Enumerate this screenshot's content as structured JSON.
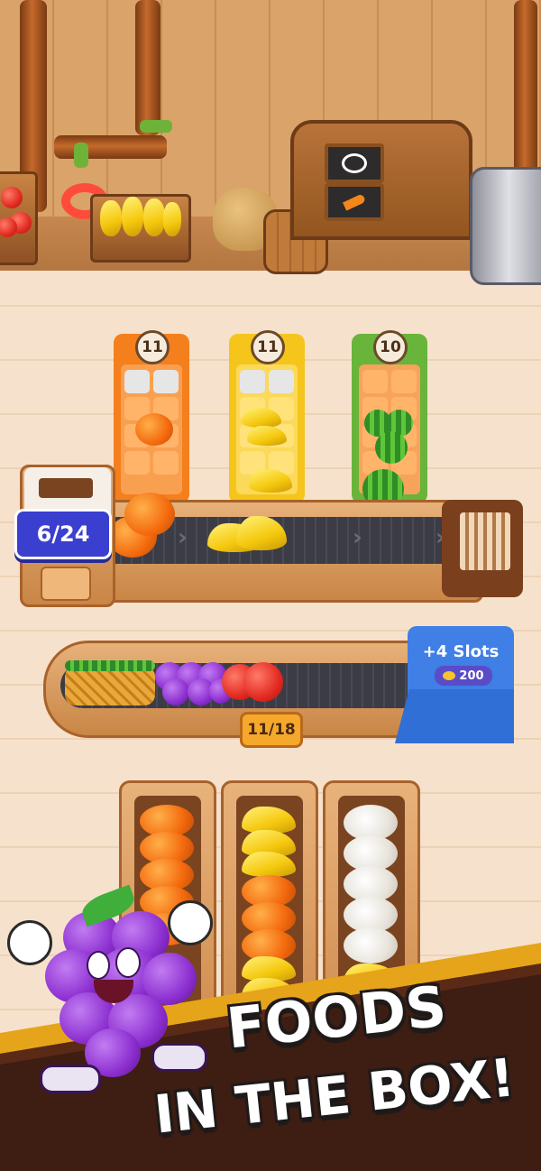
{
  "counters": {
    "belt_count": "6/24",
    "queue_count": "11/18"
  },
  "trays": [
    {
      "count": "11",
      "fruit": "pumpkin",
      "color": "#f47f1c"
    },
    {
      "count": "11",
      "fruit": "banana",
      "color": "#f6c51b"
    },
    {
      "count": "10",
      "fruit": "watermelon",
      "color": "#69b43a"
    }
  ],
  "upgrade": {
    "title": "+4 Slots",
    "cost": "200",
    "color": "#3f7fe6"
  },
  "sign_icons": [
    "ring-icon",
    "carrot-icon"
  ],
  "banner": {
    "line1": "FOODS",
    "line2": "IN THE BOX!"
  },
  "colors": {
    "badge_blue": "#3b3fd0",
    "queue_badge": "#f5a82c",
    "banner_dark": "#3e1d12",
    "banner_stripe": "#e6a41b"
  }
}
